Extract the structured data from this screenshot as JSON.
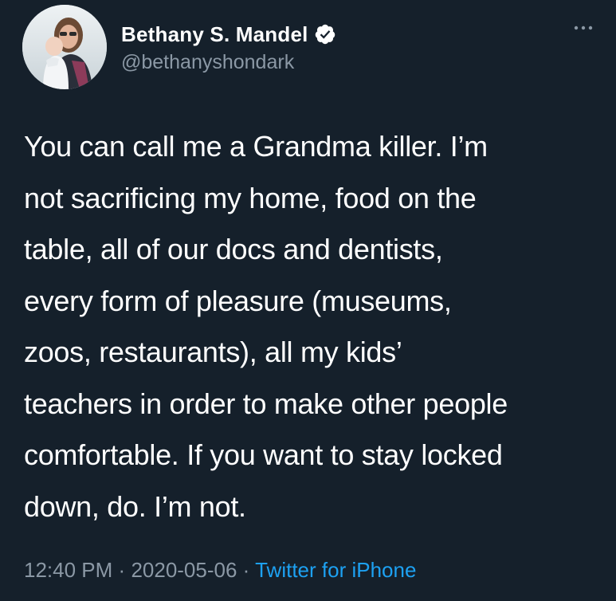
{
  "tweet": {
    "author": {
      "display_name": "Bethany S. Mandel",
      "handle": "@bethanyshondark",
      "verified": true,
      "avatar_icon": "profile-photo",
      "verified_icon": "verified-badge-icon"
    },
    "more_icon": "ellipsis-icon",
    "lines": [
      "You can call me a Grandma killer. I’m",
      "not sacrificing my home, food on the",
      "table, all of our docs and dentists,",
      "every form of pleasure (museums,",
      "zoos, restaurants), all my kids’",
      "teachers in order to make other people",
      "comfortable. If you want to stay locked",
      "down, do. I’m not."
    ],
    "time": "12:40 PM",
    "date": "2020-05-06",
    "separator": "·",
    "source": "Twitter for iPhone"
  },
  "colors": {
    "background": "#15202b",
    "text": "#ffffff",
    "secondary_text": "#8b98a5",
    "link": "#1da1f2"
  }
}
